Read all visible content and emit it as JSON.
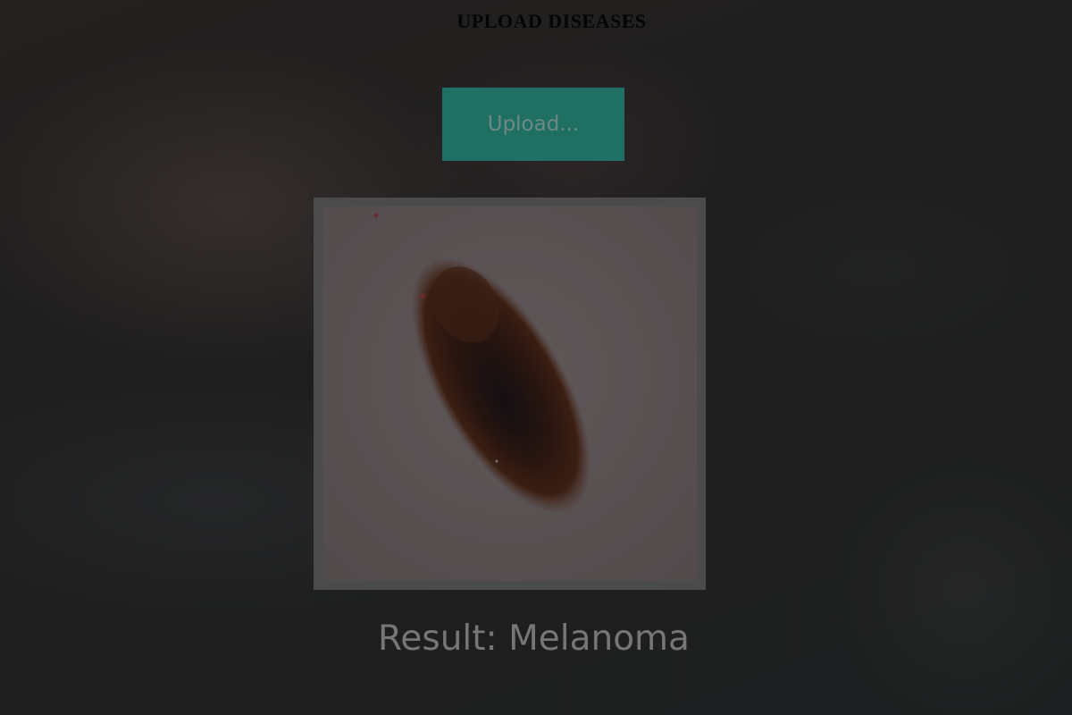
{
  "page": {
    "title": "UPLOAD DISEASES"
  },
  "upload": {
    "button_label": "Upload..."
  },
  "preview": {
    "image_subject": "skin lesion photo"
  },
  "result": {
    "prefix": "Result:",
    "diagnosis": "Melanoma"
  },
  "colors": {
    "background": "#1c1c1c",
    "button": "#1f6f62",
    "frame_border": "#4b4b4b",
    "result_text": "#767676"
  }
}
